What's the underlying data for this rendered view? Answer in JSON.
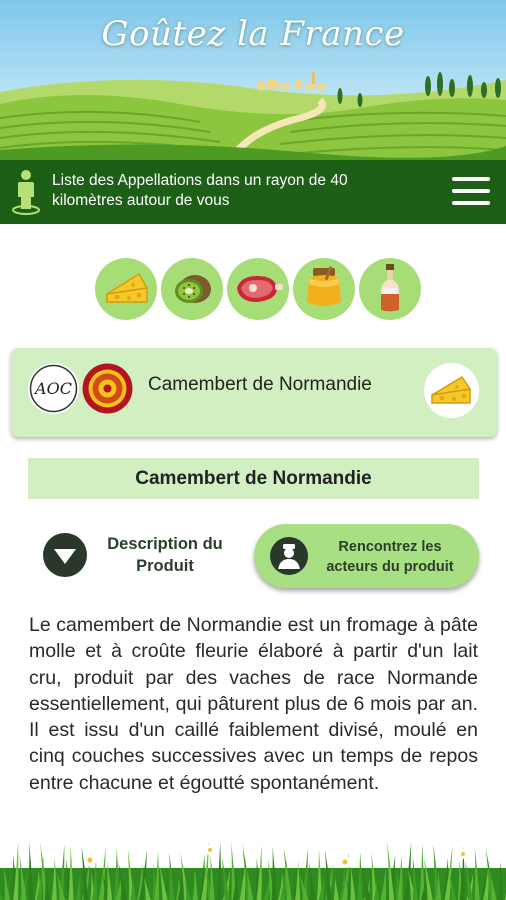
{
  "app": {
    "title": "Goûtez la France"
  },
  "topbar": {
    "subtitle": "Liste des Appellations dans un rayon de 40 kilomètres autour de vous",
    "location_icon": "person-location-icon",
    "menu_icon": "hamburger-menu-icon"
  },
  "categories": [
    {
      "name": "cheese",
      "icon": "cheese-icon"
    },
    {
      "name": "fruit",
      "icon": "kiwi-icon"
    },
    {
      "name": "meat",
      "icon": "ham-icon"
    },
    {
      "name": "honey",
      "icon": "honey-pot-icon"
    },
    {
      "name": "drinks",
      "icon": "bottle-icon"
    }
  ],
  "product_card": {
    "title": "Camembert de Normandie",
    "labels": [
      "AOC",
      "AOP"
    ],
    "category_icon": "cheese-icon"
  },
  "section": {
    "title": "Camembert de Normandie"
  },
  "actions": {
    "description_label": "Description du Produit",
    "actors_label": "Rencontrez les acteurs du produit"
  },
  "description": {
    "text": "Le camembert de Normandie est un fromage à pâte molle et à croûte fleurie élaboré à partir d'un lait cru, produit par des vaches de race Normande essentiellement, qui pâturent plus de 6 mois par an. Il est issu d'un caillé faiblement divisé, moulé en cinq couches successives avec un temps de repos entre chacune et égoutté spontanément."
  },
  "colors": {
    "dark_green": "#1e5f17",
    "light_green": "#d2efc1",
    "button_green": "#a8df83",
    "circle_green": "#a6dd77"
  }
}
